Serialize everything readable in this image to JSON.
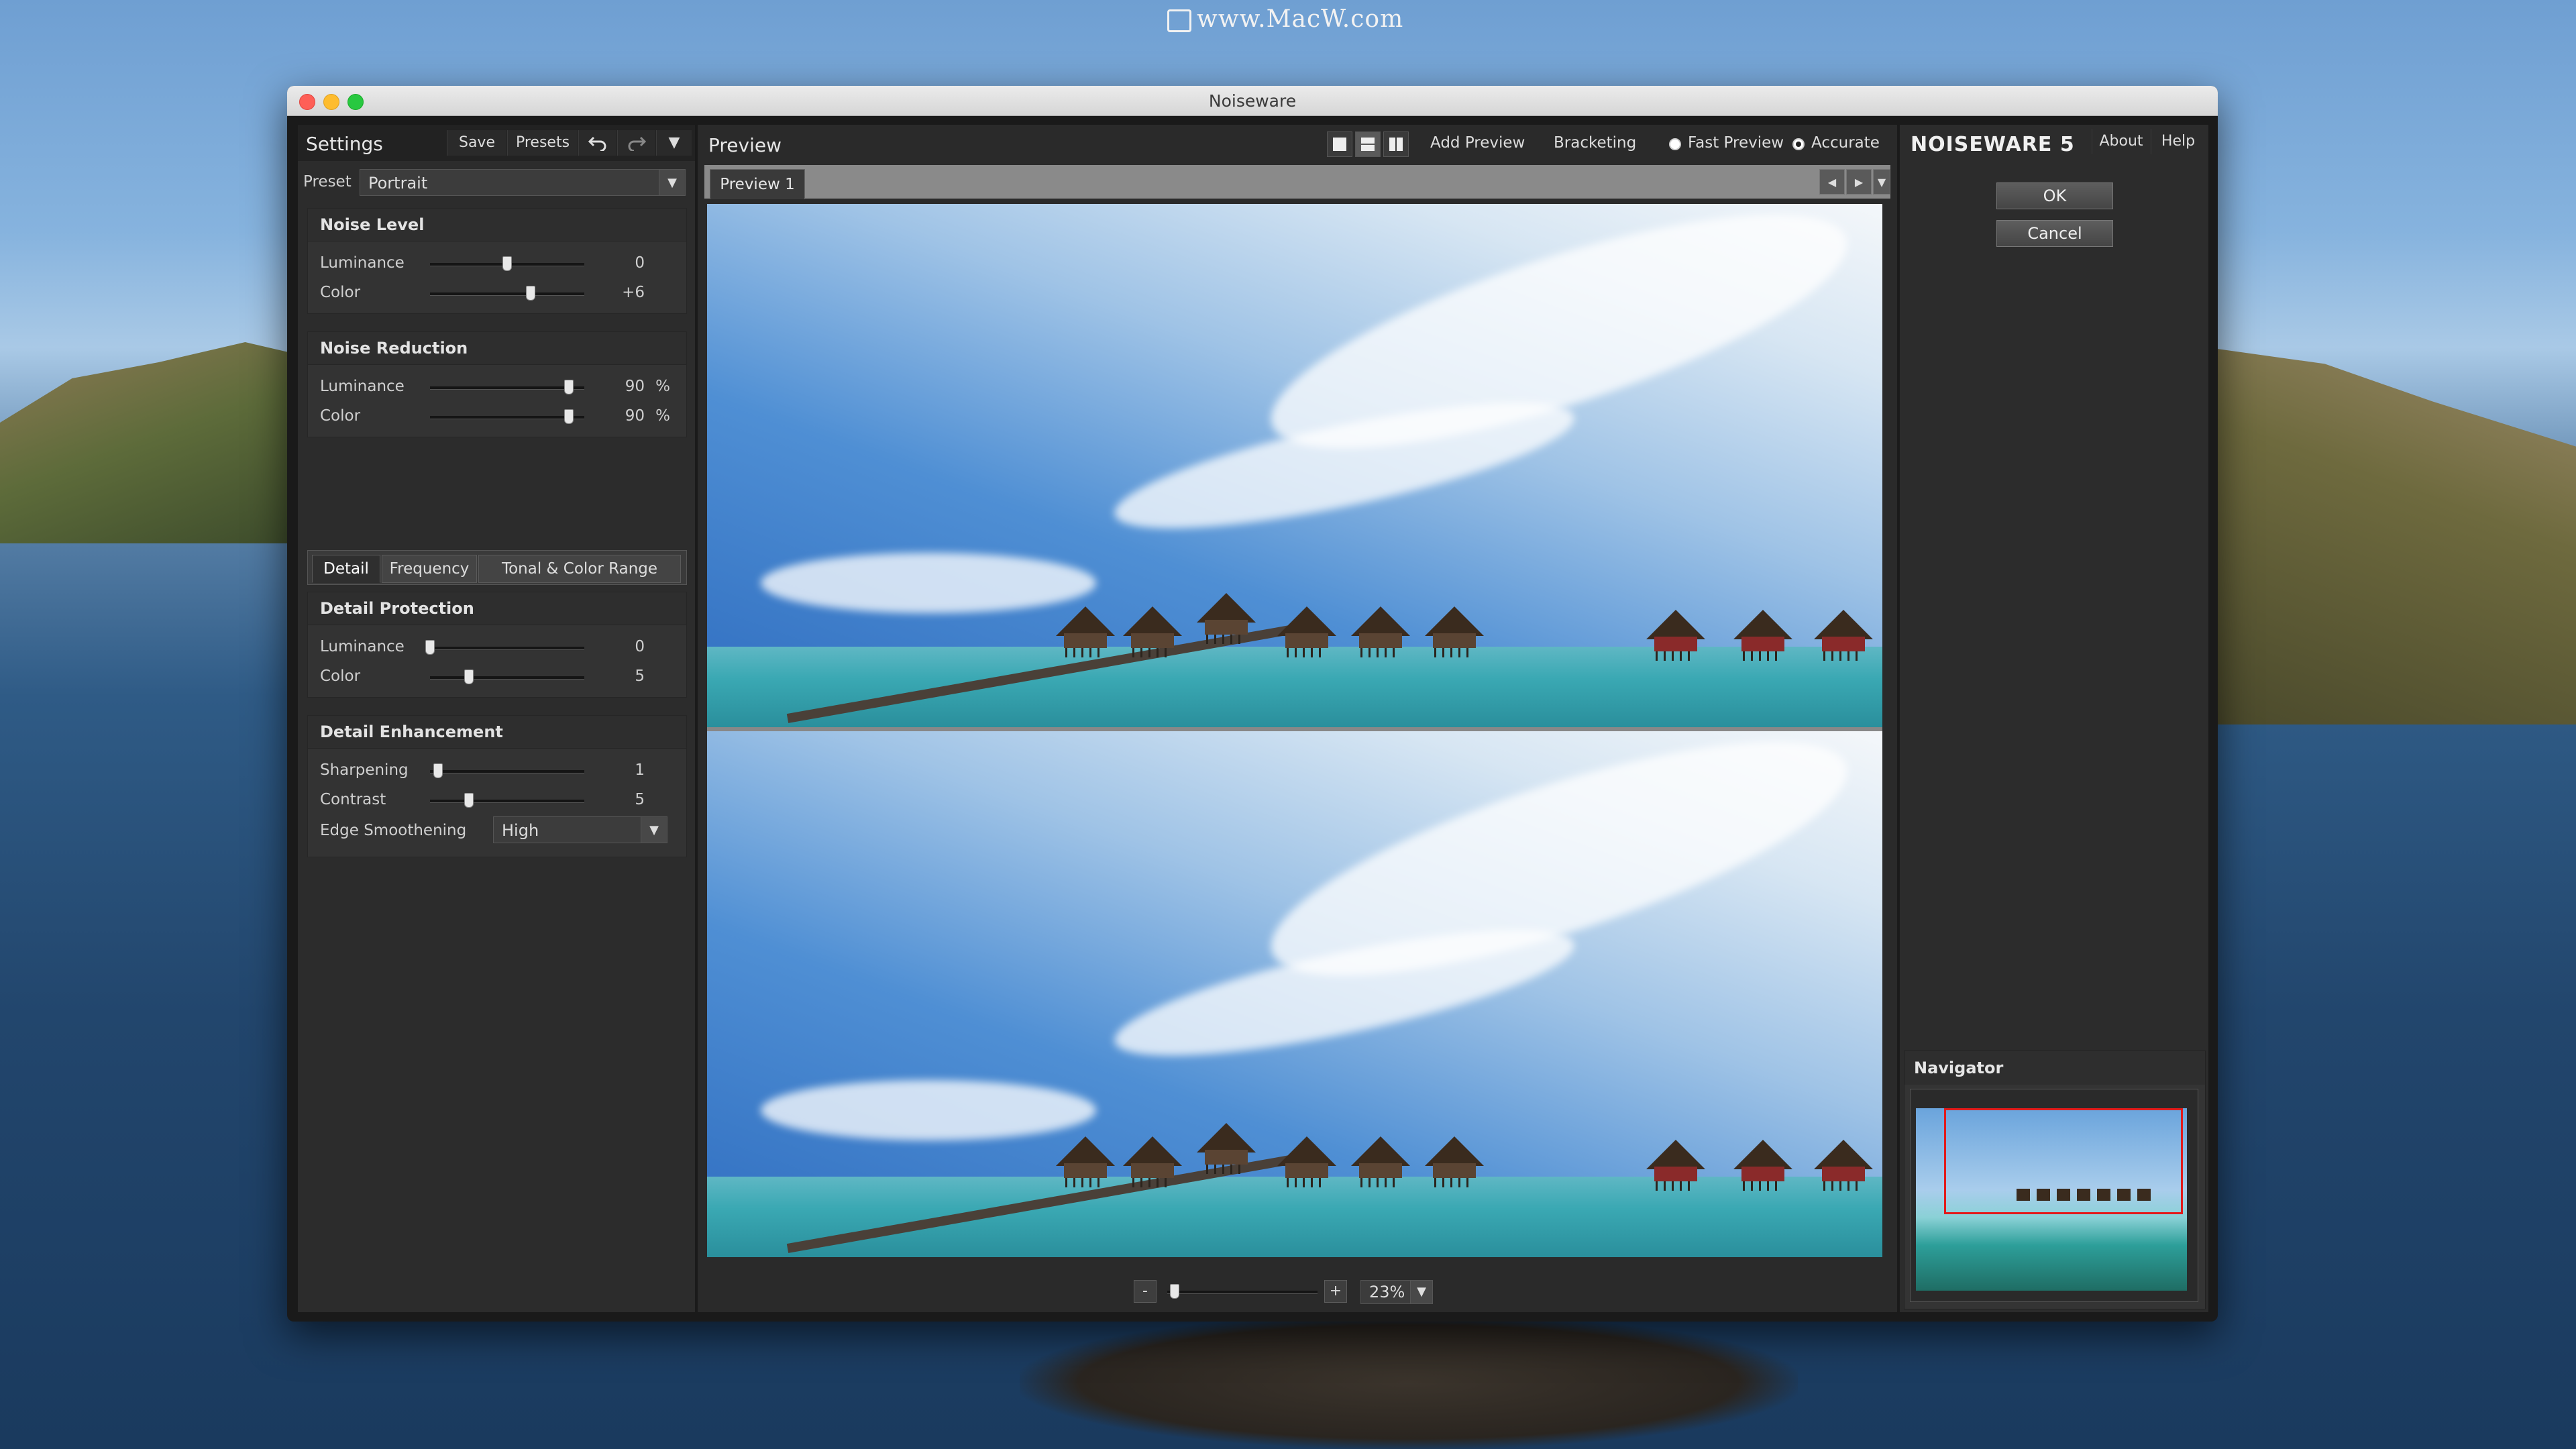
{
  "watermark": "www.MacW.com",
  "window": {
    "title": "Noiseware"
  },
  "settings": {
    "title": "Settings",
    "save_label": "Save",
    "presets_label": "Presets",
    "undo_icon": "undo-icon",
    "redo_icon": "redo-icon",
    "menu_icon": "chevron-down-icon",
    "preset_label": "Preset",
    "preset_value": "Portrait"
  },
  "noise_level": {
    "title": "Noise Level",
    "luminance": {
      "label": "Luminance",
      "value": "0",
      "unit": "",
      "fraction": 0.5
    },
    "color": {
      "label": "Color",
      "value": "+6",
      "unit": "",
      "fraction": 0.65
    }
  },
  "noise_reduction": {
    "title": "Noise Reduction",
    "luminance": {
      "label": "Luminance",
      "value": "90",
      "unit": "%",
      "fraction": 0.9
    },
    "color": {
      "label": "Color",
      "value": "90",
      "unit": "%",
      "fraction": 0.9
    }
  },
  "tabs": [
    "Detail",
    "Frequency",
    "Tonal & Color Range"
  ],
  "detail_protection": {
    "title": "Detail Protection",
    "luminance": {
      "label": "Luminance",
      "value": "0",
      "unit": "",
      "fraction": 0.0
    },
    "color": {
      "label": "Color",
      "value": "5",
      "unit": "",
      "fraction": 0.25
    }
  },
  "detail_enhancement": {
    "title": "Detail Enhancement",
    "sharpening": {
      "label": "Sharpening",
      "value": "1",
      "unit": "",
      "fraction": 0.05
    },
    "contrast": {
      "label": "Contrast",
      "value": "5",
      "unit": "",
      "fraction": 0.25
    },
    "edge_smoothing_label": "Edge Smoothening",
    "edge_smoothing_value": "High"
  },
  "preview": {
    "title": "Preview",
    "add_preview": "Add Preview",
    "bracketing": "Bracketing",
    "fast_preview": "Fast Preview",
    "accurate": "Accurate",
    "selected_mode": "accurate",
    "tab": "Preview 1",
    "zoom_value": "23%",
    "zoom_fraction": 0.05,
    "zoom_minus": "-",
    "zoom_plus": "+"
  },
  "right": {
    "brand": "NOISEWARE 5",
    "about": "About",
    "help": "Help",
    "ok": "OK",
    "cancel": "Cancel",
    "navigator": "Navigator"
  },
  "colors": {
    "accent_red": "#e21a1a",
    "panel": "#2c2c2c"
  }
}
